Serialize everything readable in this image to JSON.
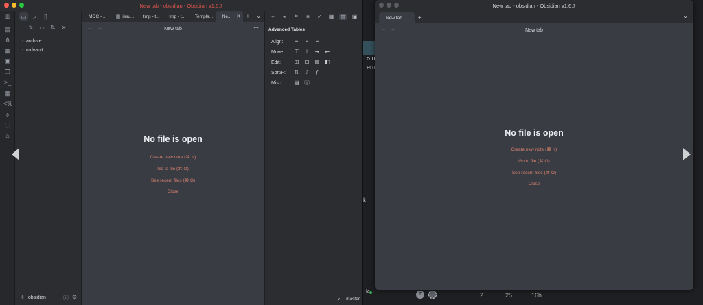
{
  "left_window": {
    "title": "New tab - obsidian - Obsidian v1.6.7",
    "title_color": "#e0574f",
    "tabs": [
      {
        "label": "MOC - ...",
        "icon": ""
      },
      {
        "label": "issu...",
        "icon": "grid-icon"
      },
      {
        "label": "tmp - t...",
        "icon": ""
      },
      {
        "label": "tmp - t...",
        "icon": ""
      },
      {
        "label": "Templa...",
        "icon": ""
      },
      {
        "label": "Ne...",
        "icon": ""
      }
    ],
    "view_title": "New tab",
    "empty_state": {
      "title": "No file is open",
      "links": [
        "Create new note (⌘ N)",
        "Go to file (⌘ O)",
        "See recent files (⌘ O)",
        "Close"
      ]
    },
    "tree": [
      {
        "label": "archive"
      },
      {
        "label": "mdvault"
      }
    ],
    "vault_name": "obsidian",
    "advanced_tables": {
      "title": "Advanced Tables",
      "rows": [
        {
          "label": "Align:"
        },
        {
          "label": "Move:"
        },
        {
          "label": "Edit:"
        },
        {
          "label": "Sort/F:"
        },
        {
          "label": "Misc:"
        }
      ]
    },
    "status": {
      "branch": "master"
    }
  },
  "right_window": {
    "title": "New tab - obsidian - Obsidian v1.6.7",
    "tab_label": "New tab",
    "view_title": "New tab",
    "empty_state": {
      "title": "No file is open",
      "links": [
        "Create new note (⌘ N)",
        "Go to file (⌘ O)",
        "See recent files (⌘ O)",
        "Close"
      ]
    }
  },
  "background": {
    "fragments": [
      "o us",
      "erro",
      "k",
      "2",
      "25",
      "16h"
    ],
    "avatar_letter": "T"
  },
  "colors": {
    "accent_link": "#d9826e",
    "traffic_red": "#ff5f57",
    "traffic_yellow": "#febc2e",
    "traffic_green": "#28c840",
    "traffic_inactive": "#5b5d62"
  }
}
